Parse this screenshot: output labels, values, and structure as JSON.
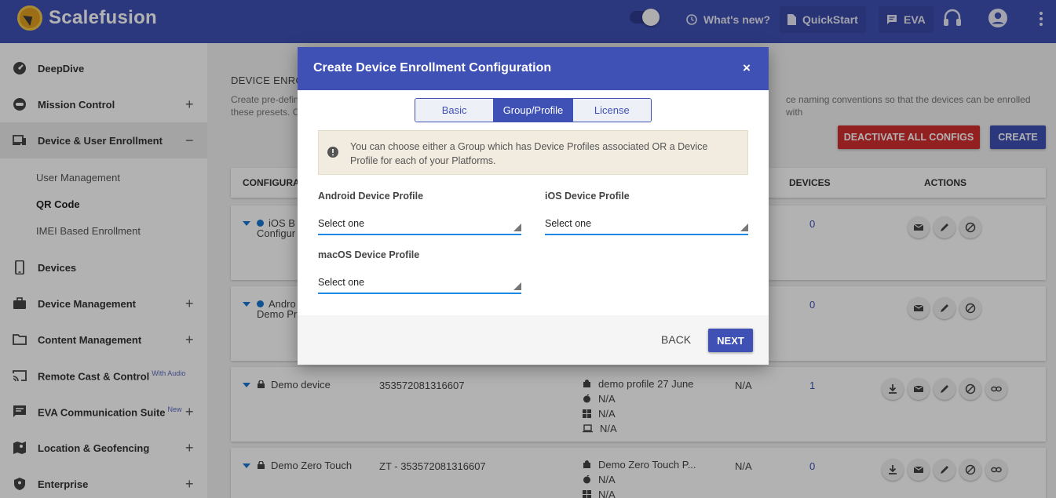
{
  "header": {
    "brand": "Scalefusion",
    "whats_new": "What's new?",
    "quickstart": "QuickStart",
    "eva": "EVA"
  },
  "sidebar": {
    "items": [
      {
        "label": "DeepDive",
        "icon": "speedometer-icon"
      },
      {
        "label": "Mission Control",
        "icon": "controller-icon",
        "expand": "+"
      },
      {
        "label": "Device & User Enrollment",
        "icon": "devices-icon",
        "expand": "−"
      },
      {
        "label": "Devices",
        "icon": "phone-icon"
      },
      {
        "label": "Device Management",
        "icon": "briefcase-icon",
        "expand": "+"
      },
      {
        "label": "Content Management",
        "icon": "folder-icon",
        "expand": "+"
      },
      {
        "label": "Remote Cast & Control",
        "icon": "cast-icon",
        "badge": "With Audio"
      },
      {
        "label": "EVA Communication Suite",
        "icon": "chat-icon",
        "badge": "New",
        "expand": "+"
      },
      {
        "label": "Location & Geofencing",
        "icon": "map-icon",
        "expand": "+"
      },
      {
        "label": "Enterprise",
        "icon": "shield-icon",
        "expand": "+"
      }
    ],
    "subitems": [
      "User Management",
      "QR Code",
      "IMEI Based Enrollment"
    ]
  },
  "page": {
    "heading": "DEVICE ENRO",
    "desc_left": "Create pre-defin",
    "desc_left2": "these presets. C",
    "desc_right": "ce naming conventions so that the devices can be enrolled with",
    "deactivate_btn": "DEACTIVATE ALL CONFIGS",
    "create_btn": "CREATE",
    "columns": {
      "config": "CONFIGURAT",
      "devices": "DEVICES",
      "actions": "ACTIONS"
    },
    "rows": [
      {
        "name1": "iOS B",
        "name2": "Configur",
        "devices": "0"
      },
      {
        "name1": "Andro",
        "name2": "Demo Pr",
        "devices": "0"
      },
      {
        "name": "Demo device",
        "imei": "353572081316607",
        "profiles": [
          "demo profile 27 June",
          "N/A",
          "N/A",
          "N/A"
        ],
        "group": "N/A",
        "devices": "1"
      },
      {
        "name": "Demo Zero Touch",
        "imei": "ZT - 353572081316607",
        "profiles": [
          "Demo Zero Touch P...",
          "N/A",
          "N/A"
        ],
        "group": "N/A",
        "devices": "0"
      }
    ]
  },
  "modal": {
    "title": "Create Device Enrollment Configuration",
    "close": "×",
    "tabs": [
      "Basic",
      "Group/Profile",
      "License"
    ],
    "active_tab": "Group/Profile",
    "info": "You can choose either a Group which has Device Profiles associated OR a Device Profile for each of your Platforms.",
    "fields": {
      "android_label": "Android Device Profile",
      "android_value": "Select one",
      "ios_label": "iOS Device Profile",
      "ios_value": "Select one",
      "macos_label": "macOS Device Profile",
      "macos_value": "Select one"
    },
    "back": "BACK",
    "next": "NEXT"
  },
  "colors": {
    "primary": "#3f51b5",
    "danger": "#d32f2f",
    "focus_underline": "#1e88e5",
    "info_bg": "#f1ecdf"
  }
}
